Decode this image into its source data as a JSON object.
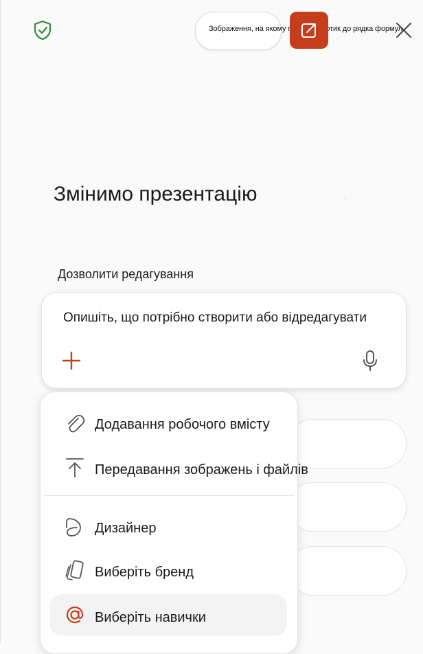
{
  "header": {
    "shield_icon": "shield-check-icon",
    "tooltip": "Зображення, на якому показано дотик до рядка формул",
    "edit_icon": "edit-square-icon",
    "close_icon": "close-icon",
    "accent_color": "#c43e1c",
    "shield_color": "#2e8b3d"
  },
  "main": {
    "title": "Змінимо презентацію",
    "allow_editing_label": "Дозволити редагування",
    "prompt": {
      "placeholder": "Опишіть, що потрібно створити або відредагувати",
      "plus_icon": "plus-icon",
      "mic_icon": "microphone-icon"
    }
  },
  "menu": {
    "items": [
      {
        "label": "Додавання робочого вмісту",
        "icon": "paperclip-icon"
      },
      {
        "label": "Передавання зображень і файлів",
        "icon": "upload-icon"
      },
      {
        "label": "Дизайнер",
        "icon": "designer-icon"
      },
      {
        "label": "Виберіть бренд",
        "icon": "brand-cards-icon"
      },
      {
        "label": "Виберіть навички",
        "icon": "at-sign-icon"
      }
    ]
  }
}
